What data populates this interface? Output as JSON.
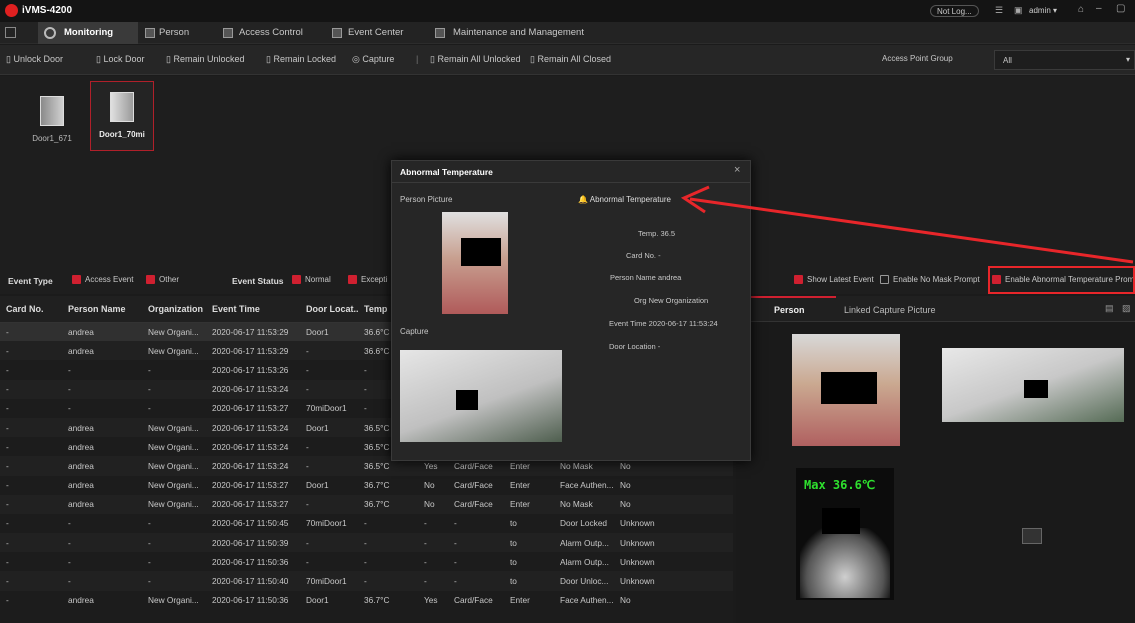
{
  "app": {
    "title": "iVMS-4200",
    "not_logged": "Not Log...",
    "user": "admin"
  },
  "tabs": [
    "Monitoring",
    "Person",
    "Access Control",
    "Event Center",
    "Maintenance and Management"
  ],
  "toolbar": {
    "items": [
      "Unlock Door",
      "Lock Door",
      "Remain Unlocked",
      "Remain Locked",
      "Capture",
      "Remain All Unlocked",
      "Remain All Closed"
    ],
    "group_label": "Access Point Group",
    "group_value": "All"
  },
  "doors": [
    "Door1_671",
    "Door1_70mi"
  ],
  "filters": {
    "event_type": "Event Type",
    "access_event": "Access Event",
    "other": "Other",
    "event_status": "Event Status",
    "normal": "Normal",
    "exception": "Excepti",
    "show_latest": "Show Latest Event",
    "no_mask": "Enable No Mask Prompt",
    "abnormal": "Enable Abnormal Temperature Prompt"
  },
  "table": {
    "headers": [
      "Card No.",
      "Person Name",
      "Organization",
      "Event Time",
      "Door Locat...",
      "Temp",
      "",
      "",
      "",
      "",
      ""
    ],
    "rows": [
      [
        "-",
        "andrea",
        "New Organi...",
        "2020-06-17 11:53:29",
        "Door1",
        "36.6°C",
        "",
        "",
        "",
        "",
        ""
      ],
      [
        "-",
        "andrea",
        "New Organi...",
        "2020-06-17 11:53:29",
        "-",
        "36.6°C",
        "",
        "",
        "",
        "",
        ""
      ],
      [
        "-",
        "-",
        "-",
        "2020-06-17 11:53:26",
        "-",
        "-",
        "",
        "",
        "",
        "",
        ""
      ],
      [
        "-",
        "-",
        "-",
        "2020-06-17 11:53:24",
        "-",
        "-",
        "",
        "",
        "",
        "",
        ""
      ],
      [
        "-",
        "-",
        "-",
        "2020-06-17 11:53:27",
        "70miDoor1",
        "-",
        "",
        "",
        "",
        "",
        ""
      ],
      [
        "-",
        "andrea",
        "New Organi...",
        "2020-06-17 11:53:24",
        "Door1",
        "36.5°C",
        "",
        "",
        "",
        "",
        ""
      ],
      [
        "-",
        "andrea",
        "New Organi...",
        "2020-06-17 11:53:24",
        "-",
        "36.5°C",
        "",
        "",
        "",
        "",
        ""
      ],
      [
        "-",
        "andrea",
        "New Organi...",
        "2020-06-17 11:53:24",
        "-",
        "36.5°C",
        "Yes",
        "Card/Face",
        "Enter",
        "No Mask",
        "No"
      ],
      [
        "-",
        "andrea",
        "New Organi...",
        "2020-06-17 11:53:27",
        "Door1",
        "36.7°C",
        "No",
        "Card/Face",
        "Enter",
        "Face Authen...",
        "No"
      ],
      [
        "-",
        "andrea",
        "New Organi...",
        "2020-06-17 11:53:27",
        "-",
        "36.7°C",
        "No",
        "Card/Face",
        "Enter",
        "No Mask",
        "No"
      ],
      [
        "-",
        "-",
        "-",
        "2020-06-17 11:50:45",
        "70miDoor1",
        "-",
        "-",
        "-",
        "to",
        "Door Locked",
        "Unknown"
      ],
      [
        "-",
        "-",
        "-",
        "2020-06-17 11:50:39",
        "-",
        "-",
        "-",
        "-",
        "to",
        "Alarm Outp...",
        "Unknown"
      ],
      [
        "-",
        "-",
        "-",
        "2020-06-17 11:50:36",
        "-",
        "-",
        "-",
        "-",
        "to",
        "Alarm Outp...",
        "Unknown"
      ],
      [
        "-",
        "-",
        "-",
        "2020-06-17 11:50:40",
        "70miDoor1",
        "-",
        "-",
        "-",
        "to",
        "Door Unloc...",
        "Unknown"
      ],
      [
        "-",
        "andrea",
        "New Organi...",
        "2020-06-17 11:50:36",
        "Door1",
        "36.7°C",
        "Yes",
        "Card/Face",
        "Enter",
        "Face Authen...",
        "No"
      ]
    ]
  },
  "right": {
    "person_tab": "Person",
    "linked_tab": "Linked Capture Picture",
    "thermal": "Max 36.6℃"
  },
  "modal": {
    "title": "Abnormal Temperature",
    "person_picture": "Person Picture",
    "capture": "Capture",
    "alarm": "Abnormal Temperature",
    "temp": "Temp. 36.5",
    "card": "Card No. -",
    "name": "Person Name andrea",
    "org": "Org New Organization",
    "time": "Event Time 2020-06-17 11:53:24",
    "door": "Door Location -"
  },
  "colors": {
    "accent": "#d02030",
    "bg": "#1b1b1b",
    "arrow": "#e8262a"
  }
}
